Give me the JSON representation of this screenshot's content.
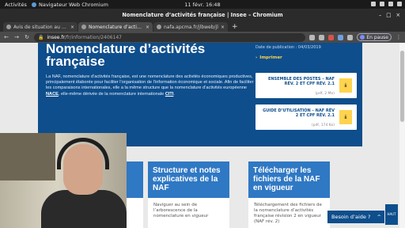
{
  "topbar": {
    "activities": "Activités",
    "app_name": "Navigateur Web Chromium",
    "clock": "11 févr.  16:48"
  },
  "window": {
    "title": "Nomenclature d’activités française | Insee – Chromium"
  },
  "tabs": [
    {
      "label": "Avis de situation au répe"
    },
    {
      "label": "Nomenclature d’activités"
    },
    {
      "label": "nafa.apcma.fr/jlbweb/jl"
    }
  ],
  "address": {
    "host": "insee.fr",
    "path": "/fr/information/2406147"
  },
  "profile": {
    "label": "En pause"
  },
  "page": {
    "title": "Nomenclature d’activités française",
    "desc_1": "La NAF, nomenclature d’activités française, est une nomenclature des activités économiques productives, principalement élaborée pour faciliter l’organisation de l’information économique et sociale. Afin de faciliter les comparaisons internationales, elle a la même structure que la nomenclature d’activités européenne ",
    "desc_nace": "NACE",
    "desc_2": ", elle-même dérivée de la nomenclature internationale ",
    "desc_citi": "CITI",
    "desc_3": ".",
    "pub_date": "Date de publication : 04/03/2019",
    "print": "Imprimer",
    "docs": [
      {
        "title": "ENSEMBLE DES POSTES – NAF RÉV. 2 ET CPF RÉV. 2.1",
        "meta": "(pdf, 2 Mo)"
      },
      {
        "title": "GUIDE D’UTILISATION – NAF RÉV 2 ET CPF RÉV. 2.1",
        "meta": "(pdf, 174 Ko)"
      }
    ],
    "cards": [
      {
        "title": "",
        "text": ""
      },
      {
        "title": "Structure et notes explicatives de la NAF",
        "text": "Naviguer au sein de l’arborescence de la nomenclature en vigueur"
      },
      {
        "title": "Télécharger les fichiers de la NAF en vigueur",
        "text": "Téléchargement des fichiers de la nomenclature d’activités française révision 2 en vigueur (NAF rév. 2)"
      }
    ],
    "help": "Besoin d’aide ?",
    "top": "HAUT"
  }
}
